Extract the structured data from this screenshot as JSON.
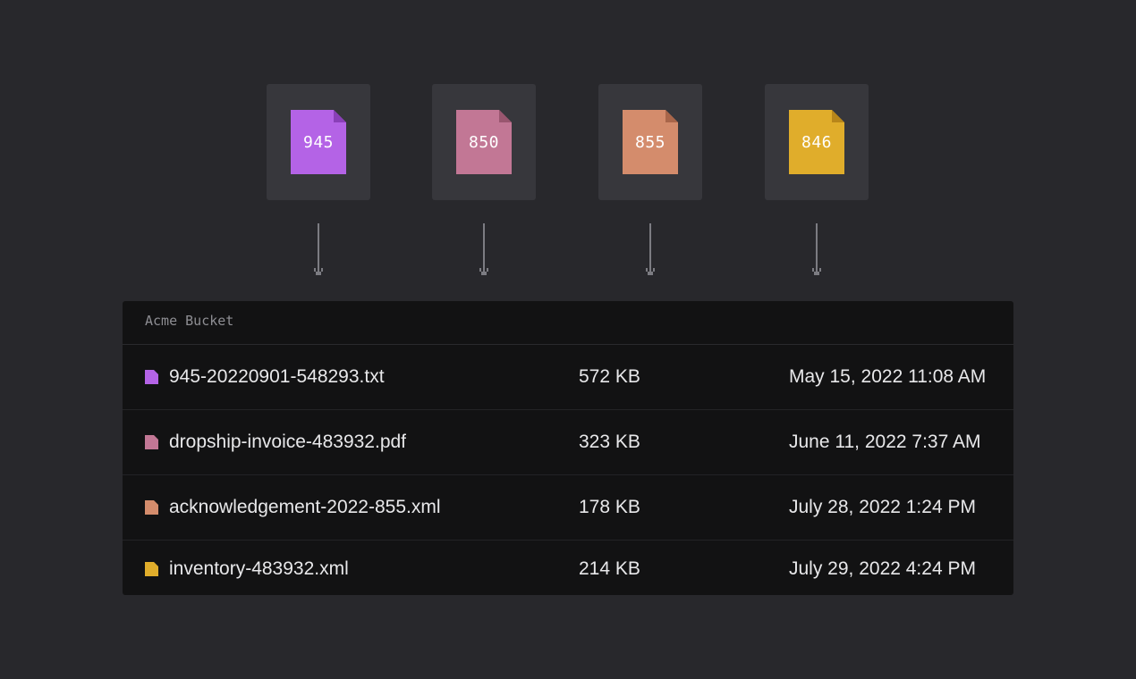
{
  "documents": [
    {
      "code": "945",
      "color": "#b463e6",
      "fold": "#8a3fb8"
    },
    {
      "code": "850",
      "color": "#c27795",
      "fold": "#99566f"
    },
    {
      "code": "855",
      "color": "#d48c6c",
      "fold": "#a9664a"
    },
    {
      "code": "846",
      "color": "#e0ad2b",
      "fold": "#b8861a"
    }
  ],
  "bucket": {
    "title": "Acme Bucket",
    "files": [
      {
        "name": "945-20220901-548293.txt",
        "size": "572 KB",
        "date": "May 15, 2022 11:08 AM",
        "color": "#b463e6"
      },
      {
        "name": "dropship-invoice-483932.pdf",
        "size": "323 KB",
        "date": "June 11, 2022 7:37 AM",
        "color": "#c27795"
      },
      {
        "name": "acknowledgement-2022-855.xml",
        "size": "178 KB",
        "date": "July 28, 2022 1:24 PM",
        "color": "#d48c6c"
      },
      {
        "name": "inventory-483932.xml",
        "size": "214 KB",
        "date": "July 29, 2022 4:24 PM",
        "color": "#e0ad2b"
      }
    ]
  }
}
